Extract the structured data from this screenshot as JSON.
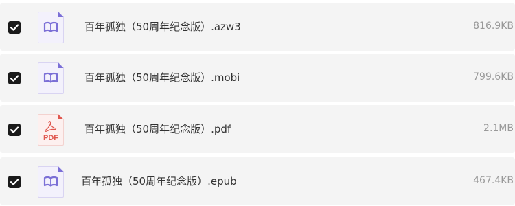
{
  "files": [
    {
      "name": "百年孤独（50周年纪念版）.azw3",
      "size": "816.9KB",
      "icon": "ebook-icon",
      "checked": true
    },
    {
      "name": "百年孤独（50周年纪念版）.mobi",
      "size": "799.6KB",
      "icon": "ebook-icon",
      "checked": true
    },
    {
      "name": "百年孤独（50周年纪念版）.pdf",
      "size": "2.1MB",
      "icon": "pdf-icon",
      "icon_label": "PDF",
      "checked": true
    },
    {
      "name": "百年孤独（50周年纪念版）.epub",
      "size": "467.4KB",
      "icon": "ebook-icon",
      "checked": true
    }
  ],
  "colors": {
    "row_bg": "#f4f4f4",
    "ebook_icon_accent": "#7b6fd6",
    "pdf_icon_accent": "#e0574f",
    "checkbox": "#1a1a1a",
    "size_text": "#999999"
  }
}
